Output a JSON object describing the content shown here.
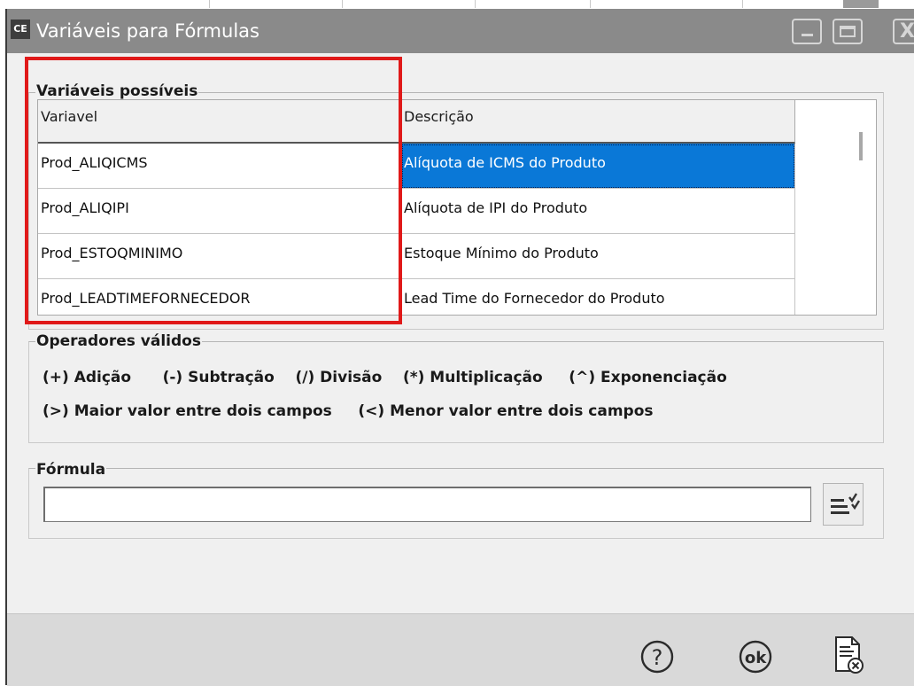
{
  "window": {
    "app_badge": "CE",
    "title": "Variáveis para Fórmulas"
  },
  "variables_group": {
    "label": "Variáveis possíveis",
    "columns": [
      "Variavel",
      "Descrição"
    ],
    "rows": [
      {
        "variavel": "Prod_ALIQICMS",
        "descricao": "Alíquota de ICMS do Produto",
        "selected": true
      },
      {
        "variavel": "Prod_ALIQIPI",
        "descricao": "Alíquota de IPI do Produto",
        "selected": false
      },
      {
        "variavel": "Prod_ESTOQMINIMO",
        "descricao": "Estoque Mínimo do Produto",
        "selected": false
      },
      {
        "variavel": "Prod_LEADTIMEFORNECEDOR",
        "descricao": "Lead Time do Fornecedor do Produto",
        "selected": false
      }
    ]
  },
  "operators_group": {
    "label": "Operadores válidos",
    "line1": "(+) Adição      (-) Subtração    (/) Divisão    (*) Multiplicação     (^) Exponenciação",
    "line2": "(>) Maior valor entre dois campos     (<) Menor valor entre dois campos"
  },
  "formula_group": {
    "label": "Fórmula",
    "value": ""
  },
  "footer": {
    "buttons": [
      "help-icon",
      "ok-icon",
      "cancel-document-icon"
    ]
  },
  "colors": {
    "titlebar": "#8a8a8a",
    "selection": "#0a78d7",
    "highlight": "#e01919"
  }
}
